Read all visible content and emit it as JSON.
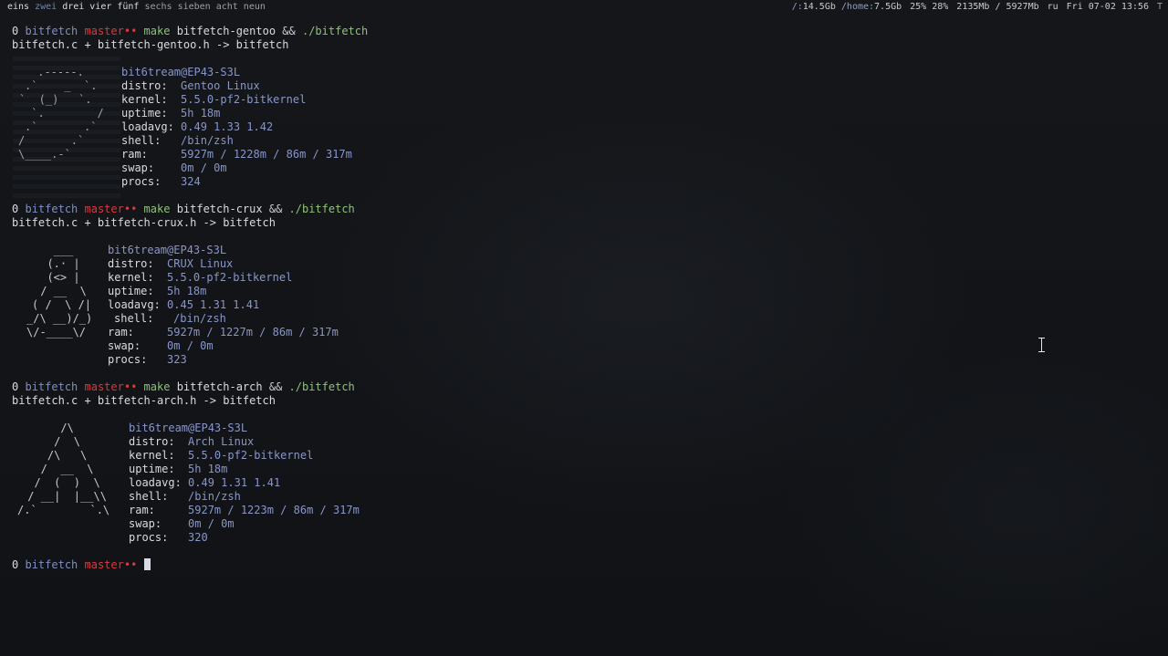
{
  "bar": {
    "workspaces": [
      {
        "label": "eins",
        "state": "occupied"
      },
      {
        "label": "zwei",
        "state": "focused"
      },
      {
        "label": "drei",
        "state": "occupied"
      },
      {
        "label": "vier",
        "state": "occupied"
      },
      {
        "label": "fünf",
        "state": "occupied"
      },
      {
        "label": "sechs",
        "state": "empty"
      },
      {
        "label": "sieben",
        "state": "empty"
      },
      {
        "label": "acht",
        "state": "empty"
      },
      {
        "label": "neun",
        "state": "empty"
      }
    ],
    "disk_root_key": "/:",
    "disk_root_val": "14.5Gb",
    "disk_home_key": "/home:",
    "disk_home_val": "7.5Gb",
    "cpu": "25% 28%",
    "mem": "2135Mb / 5927Mb",
    "lang": "ru",
    "datetime": "Fri 07-02 13:56",
    "tray": "T"
  },
  "prompt": {
    "num": "0",
    "dir": "bitfetch",
    "branch": "master",
    "dots": "••"
  },
  "blocks": [
    {
      "make": "make",
      "target": "bitfetch-gentoo",
      "op": "&&",
      "run": "./bitfetch",
      "build": "bitfetch.c + bitfetch-gentoo.h -> bitfetch",
      "logo": [
        " .-----.",
        ".`    _  `.",
        "`  (_)   `.",
        " `.        /",
        ".`       .`",
        "/       .`",
        "\\____.-`"
      ],
      "info": {
        "host": "bit6tream@EP43-S3L",
        "distro_label": "distro:",
        "distro": "Gentoo Linux",
        "kernel_label": "kernel:",
        "kernel": "5.5.0-pf2-bitkernel",
        "uptime_label": "uptime:",
        "uptime": "5h 18m",
        "loadavg_label": "loadavg:",
        "loadavg": "0.49 1.33 1.42",
        "shell_label": "shell:",
        "shell": "/bin/zsh",
        "ram_label": "ram:",
        "ram": "5927m / 1228m / 86m / 317m",
        "swap_label": "swap:",
        "swap": "0m / 0m",
        "procs_label": "procs:",
        "procs": "324"
      }
    },
    {
      "make": "make",
      "target": "bitfetch-crux",
      "op": "&&",
      "run": "./bitfetch",
      "build": "bitfetch.c + bitfetch-crux.h -> bitfetch",
      "logo": [
        "   ___",
        "  (.· |",
        "  (<> |",
        " / __  \\",
        "( /  \\ /|",
        "_/\\ __)/_)",
        "\\/-____\\/"
      ],
      "info": {
        "host": "bit6tream@EP43-S3L",
        "distro_label": "distro:",
        "distro": "CRUX Linux",
        "kernel_label": "kernel:",
        "kernel": "5.5.0-pf2-bitkernel",
        "uptime_label": "uptime:",
        "uptime": "5h 18m",
        "loadavg_label": "loadavg:",
        "loadavg": "0.45 1.31 1.41",
        "shell_label": "shell:",
        "shell": "/bin/zsh",
        "ram_label": "ram:",
        "ram": "5927m / 1227m / 86m / 317m",
        "swap_label": "swap:",
        "swap": "0m / 0m",
        "procs_label": "procs:",
        "procs": "323"
      }
    },
    {
      "make": "make",
      "target": "bitfetch-arch",
      "op": "&&",
      "run": "./bitfetch",
      "build": "bitfetch.c + bitfetch-arch.h -> bitfetch",
      "logo": [
        "      /\\",
        "     /  \\",
        "    /\\   \\",
        "   /  __  \\",
        "  /  (  )  \\",
        " / __|  |__\\\\",
        "/.`        `.\\"
      ],
      "info": {
        "host": "bit6tream@EP43-S3L",
        "distro_label": "distro:",
        "distro": "Arch Linux",
        "kernel_label": "kernel:",
        "kernel": "5.5.0-pf2-bitkernel",
        "uptime_label": "uptime:",
        "uptime": "5h 18m",
        "loadavg_label": "loadavg:",
        "loadavg": "0.49 1.31 1.41",
        "shell_label": "shell:",
        "shell": "/bin/zsh",
        "ram_label": "ram:",
        "ram": "5927m / 1223m / 86m / 317m",
        "swap_label": "swap:",
        "swap": "0m / 0m",
        "procs_label": "procs:",
        "procs": "320"
      }
    }
  ],
  "colors": {
    "bg": "#121418",
    "branch": "#e0353d",
    "dir": "#7f8fc4",
    "make": "#8ec27a",
    "value": "#8996c9"
  }
}
